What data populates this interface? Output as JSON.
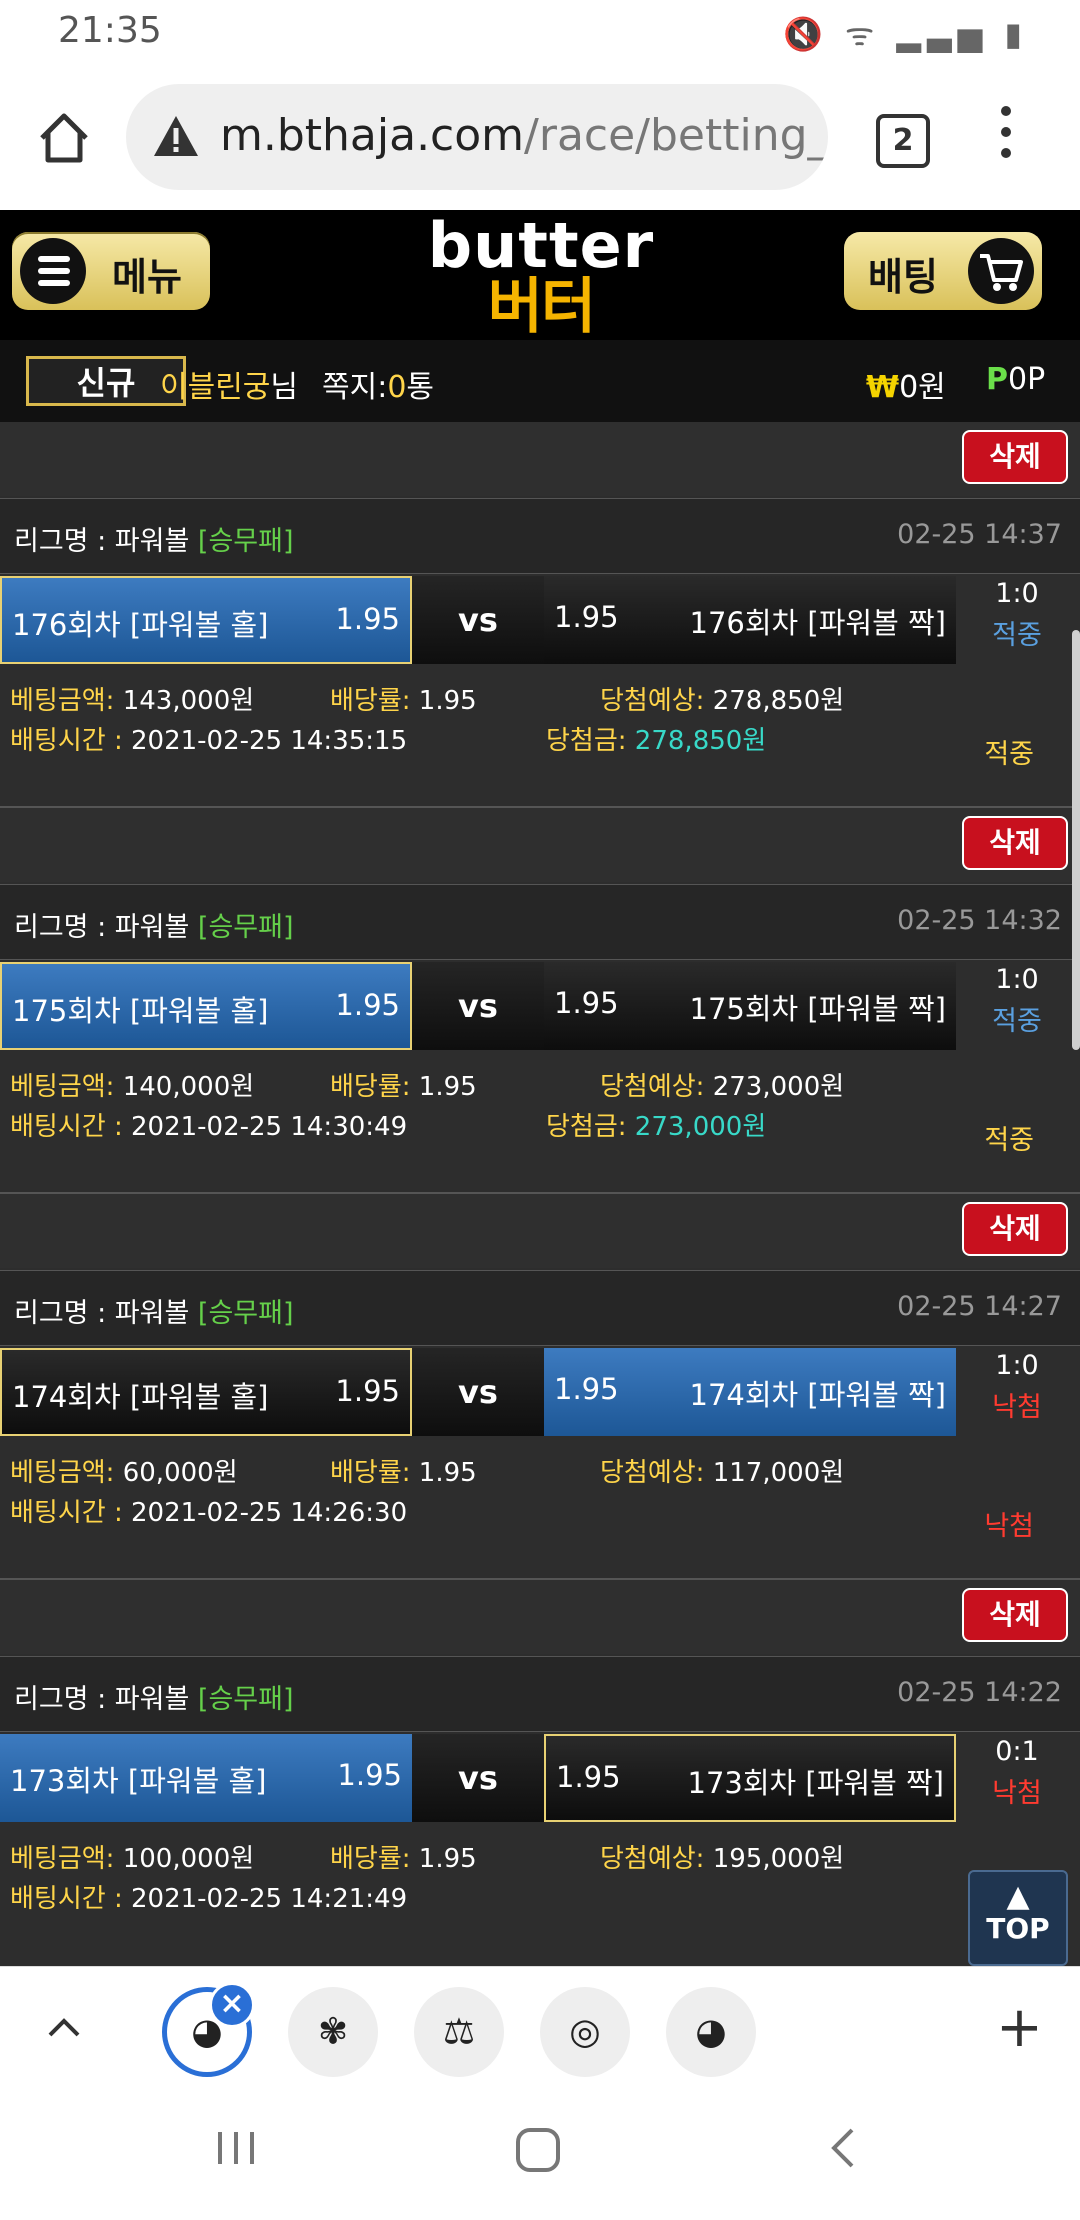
{
  "status": {
    "time": "21:35",
    "icons_text": "🔇 ᯤ ▂▃▅ ▮"
  },
  "browser": {
    "url_main": "m.bthaja.com",
    "url_path": "/race/betting_li",
    "tab_count": "2",
    "icons": [
      "home-icon",
      "warning-icon",
      "tabs-icon",
      "more-icon"
    ]
  },
  "header": {
    "menu_label": "메뉴",
    "logo_en": "butter",
    "logo_ko": "버터",
    "bet_label": "배팅"
  },
  "user": {
    "badge": "신규",
    "name": "이블린궁",
    "name_suffix": "님",
    "msg_label": "쪽지:",
    "msg_count": "0",
    "msg_unit": "통",
    "won_symbol": "₩",
    "won_value": "0원",
    "point_symbol": "P",
    "point_value": "0P"
  },
  "labels": {
    "delete": "삭제",
    "league_prefix": "리그명 : ",
    "vs": "vs",
    "bet_amount": "베팅금액:",
    "odds": "배당률:",
    "expected": "당첨예상:",
    "bet_time": "배팅시간 :",
    "win_amount": "당첨금:",
    "top": "TOP"
  },
  "bets": [
    {
      "league": "파워볼",
      "type": "[승무패]",
      "date": "02-25 14:37",
      "left_team": "176회차 [파워볼 홀]",
      "left_odd": "1.95",
      "right_team": "176회차 [파워볼 짝]",
      "right_odd": "1.95",
      "score": "1:0",
      "result": "적중",
      "bet_amount": "143,000원",
      "odds": "1.95",
      "expected": "278,850원",
      "bet_time": "2021-02-25 14:35:15",
      "win_amount": "278,850원",
      "status": "적중"
    },
    {
      "league": "파워볼",
      "type": "[승무패]",
      "date": "02-25 14:32",
      "left_team": "175회차 [파워볼 홀]",
      "left_odd": "1.95",
      "right_team": "175회차 [파워볼 짝]",
      "right_odd": "1.95",
      "score": "1:0",
      "result": "적중",
      "bet_amount": "140,000원",
      "odds": "1.95",
      "expected": "273,000원",
      "bet_time": "2021-02-25 14:30:49",
      "win_amount": "273,000원",
      "status": "적중"
    },
    {
      "league": "파워볼",
      "type": "[승무패]",
      "date": "02-25 14:27",
      "left_team": "174회차 [파워볼 홀]",
      "left_odd": "1.95",
      "right_team": "174회차 [파워볼 짝]",
      "right_odd": "1.95",
      "score": "1:0",
      "result": "낙첨",
      "bet_amount": "60,000원",
      "odds": "1.95",
      "expected": "117,000원",
      "bet_time": "2021-02-25 14:26:30",
      "status": "낙첨"
    },
    {
      "league": "파워볼",
      "type": "[승무패]",
      "date": "02-25 14:22",
      "left_team": "173회차 [파워볼 홀]",
      "left_odd": "1.95",
      "right_team": "173회차 [파워볼 짝]",
      "right_odd": "1.95",
      "score": "0:1",
      "result": "낙첨",
      "bet_amount": "100,000원",
      "odds": "1.95",
      "expected": "195,000원",
      "bet_time": "2021-02-25 14:21:49"
    }
  ]
}
